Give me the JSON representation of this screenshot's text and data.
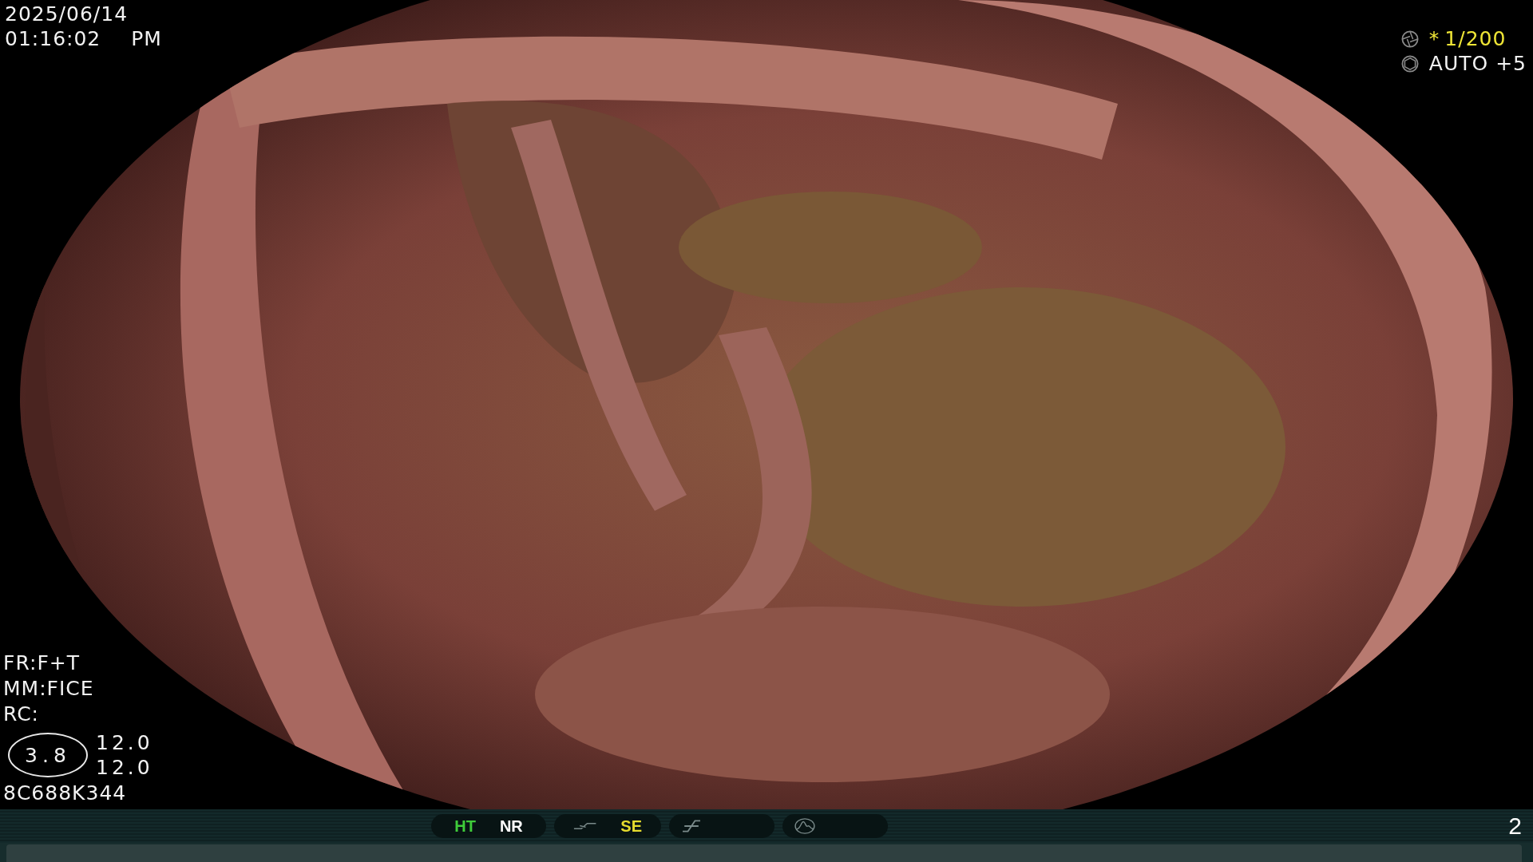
{
  "datetime": {
    "date": "2025/06/14",
    "time": "01:16:02",
    "meridiem": "PM"
  },
  "exposure": {
    "shutter_marker": "*",
    "shutter": "1/200",
    "brightness": "AUTO +5"
  },
  "settings": [
    "FR:F+T",
    "MM:FICE",
    "RC:"
  ],
  "zoom": {
    "value": "3.8",
    "readings": [
      "12.0",
      "12.0"
    ]
  },
  "serial": "8C688K344",
  "status_bar": {
    "groups": [
      {
        "kind": "text",
        "items": [
          {
            "label": "HT",
            "color": "#3fcc3a"
          },
          {
            "label": "NR",
            "color": "#ffffff"
          }
        ]
      },
      {
        "kind": "curve",
        "items": [
          {
            "label": "SE",
            "color": "#e6dc2e"
          }
        ]
      },
      {
        "kind": "slash"
      },
      {
        "kind": "peak"
      }
    ],
    "page": "2"
  }
}
